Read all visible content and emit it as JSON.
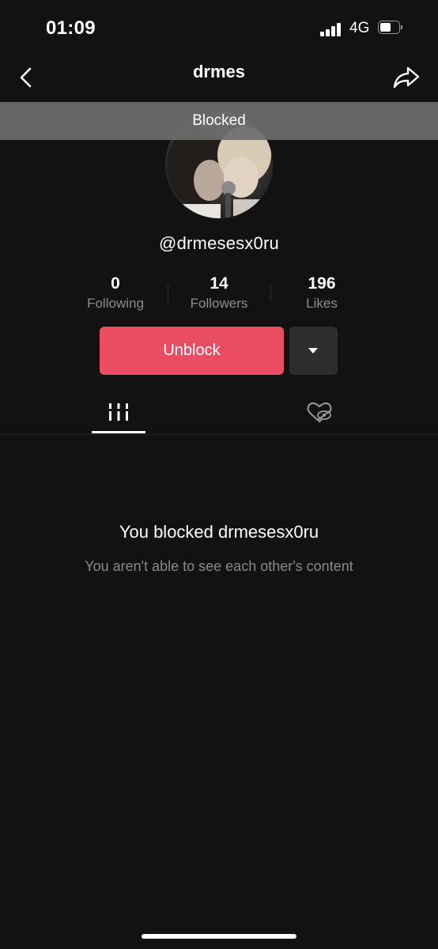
{
  "status_bar": {
    "time": "01:09",
    "network": "4G",
    "battery_level": 0.6,
    "signal_bars": 4
  },
  "header": {
    "title": "drmes",
    "back_icon": "chevron-left-icon",
    "share_icon": "share-arrow-icon"
  },
  "banner": {
    "text": "Blocked"
  },
  "profile": {
    "username": "@drmesesx0ru"
  },
  "stats": [
    {
      "value": "0",
      "label": "Following"
    },
    {
      "value": "14",
      "label": "Followers"
    },
    {
      "value": "196",
      "label": "Likes"
    }
  ],
  "actions": {
    "unblock_label": "Unblock",
    "more_icon": "caret-down-icon"
  },
  "tabs": [
    {
      "icon": "videos-grid-icon",
      "selected": true
    },
    {
      "icon": "liked-hidden-icon",
      "selected": false
    }
  ],
  "empty_state": {
    "title": "You blocked drmesesx0ru",
    "subtitle": "You aren't able to see each other's content"
  },
  "colors": {
    "background": "#121212",
    "accent": "#ea4d62",
    "secondary_button": "#2d2d2d",
    "muted_text": "#8a8a8a"
  }
}
